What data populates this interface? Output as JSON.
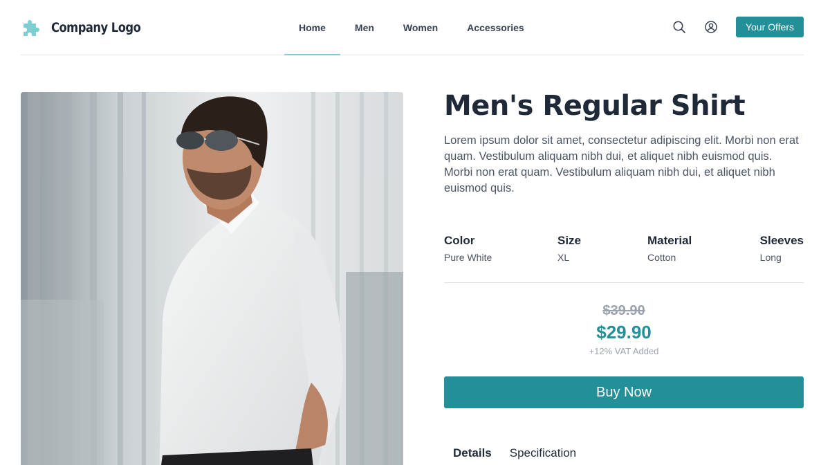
{
  "header": {
    "brand_name": "Company Logo",
    "nav": [
      {
        "label": "Home",
        "active": true
      },
      {
        "label": "Men",
        "active": false
      },
      {
        "label": "Women",
        "active": false
      },
      {
        "label": "Accessories",
        "active": false
      }
    ],
    "icons": {
      "logo": "puzzle-piece-icon",
      "search": "search-icon",
      "account": "user-circle-icon"
    },
    "offers_label": "Your Offers"
  },
  "product": {
    "image_alt_icon": "product-photo",
    "title": "Men's Regular Shirt",
    "description": "Lorem ipsum dolor sit amet, consectetur adipiscing elit. Morbi non erat quam. Vestibulum aliquam nibh dui, et aliquet nibh euismod quis. Morbi non erat quam. Vestibulum aliquam nibh dui, et aliquet nibh euismod quis.",
    "attributes": [
      {
        "label": "Color",
        "value": "Pure White"
      },
      {
        "label": "Size",
        "value": "XL"
      },
      {
        "label": "Material",
        "value": "Cotton"
      },
      {
        "label": "Sleeves",
        "value": "Long"
      }
    ],
    "old_price": "$39.90",
    "price": "$29.90",
    "vat_note": "+12% VAT Added",
    "buy_label": "Buy Now",
    "tabs": [
      {
        "label": "Details",
        "active": true
      },
      {
        "label": "Specification",
        "active": false
      }
    ]
  },
  "colors": {
    "accent": "#238f98",
    "nav_indicator": "#7ecfd4",
    "logo_icon": "#7ecfd4",
    "text_dark": "#1f2937",
    "text_muted": "#9ca3af"
  }
}
